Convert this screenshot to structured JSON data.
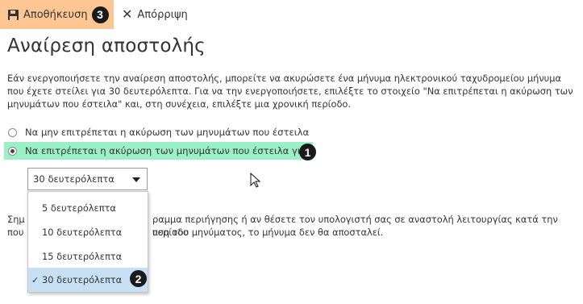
{
  "toolbar": {
    "save_label": "Αποθήκευση",
    "save_icon": "floppy-disk-icon",
    "discard_label": "Απόρριψη",
    "discard_icon": "x-icon",
    "save_highlight_color": "#fdc692"
  },
  "page": {
    "title": "Αναίρεση αποστολής",
    "description": "Εάν ενεργοποιήσετε την αναίρεση αποστολής, μπορείτε να ακυρώσετε ένα μήνυμα ηλεκτρονικού ταχυδρομείου μήνυμα που έχετε στείλει για 30 δευτερόλεπτα. Για να την ενεργοποιήσετε, επιλέξτε το στοιχείο \"Να επιτρέπεται η ακύρωση των μηνυμάτων που έστειλα\" και, στη συνέχεια, επιλέξτε μια χρονική περίοδο."
  },
  "options": {
    "radio_disallow": "Να μην επιτρέπεται η ακύρωση των μηνυμάτων που έστειλα",
    "radio_allow": "Να επιτρέπεται η ακύρωση των μηνυμάτων που έστειλα για:",
    "selected": "radio_allow",
    "allow_highlight_color": "#9bf0c5"
  },
  "period_select": {
    "value": "30 δευτερόλεπτα",
    "options": [
      "5 δευτερόλεπτα",
      "10 δευτερόλεπτα",
      "15 δευτερόλεπτα",
      "30 δευτερόλεπτα"
    ],
    "checked_index": 3,
    "check_mark": "✓",
    "hover_color": "#c7e0f4"
  },
  "note": {
    "line1_left": "Σημ",
    "line1_right": "ραμμα περιήγησης ή αν θέσετε τον υπολογιστή σας σε αναστολή λειτουργίας κατά την περίοδο",
    "line2_left": "που",
    "line2_right": "υση του μηνύματος, το μήνυμα δεν θα αποσταλεί."
  },
  "badges": {
    "save": "3",
    "allow_radio": "1",
    "dropdown_option": "2"
  }
}
